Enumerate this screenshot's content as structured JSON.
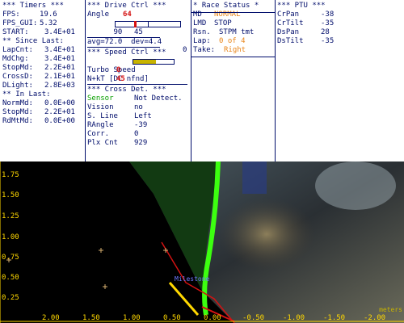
{
  "timers": {
    "header": "*** Timers ***",
    "fps_label": "FPS:",
    "fps_value": "19.6",
    "fps_gui_label": "FPS_GUI:",
    "fps_gui_value": "5.32",
    "start_label": "START:",
    "start_value": "3.4E+01",
    "since_last_header": "** Since Last:",
    "items": [
      {
        "label": "LapCnt:",
        "value": "3.4E+01"
      },
      {
        "label": "MdChg:",
        "value": "3.4E+01"
      },
      {
        "label": "StopMd:",
        "value": "2.2E+01"
      },
      {
        "label": "CrossD:",
        "value": "2.1E+01"
      },
      {
        "label": "DLight:",
        "value": "2.8E+03"
      }
    ],
    "in_last_header": "** In Last:",
    "in_last_items": [
      {
        "label": "NormMd:",
        "value": "0.0E+00"
      },
      {
        "label": "StopMd:",
        "value": "2.2E+01"
      },
      {
        "label": "RdMtMd:",
        "value": "0.0E+00"
      }
    ]
  },
  "drive": {
    "header": "*** Drive Ctrl ***",
    "angle_label": "Angle",
    "angle_value": "64",
    "slider_min": "90",
    "slider_max": "0",
    "slider_level": 0.3,
    "slider_center": "45",
    "avg_dev": "avg=72.0  dev=4.4",
    "speed_header": "*** Speed Ctrl ***",
    "speed_label": "Speed",
    "speed_value": "45",
    "speed_level": 0.55,
    "turbo_label": "Turbo",
    "turbo_value": "0",
    "nkt_text": "N+kT [DC nfnd]",
    "cross_header": "*** Cross Det. ***",
    "sensor_label": "Sensor",
    "sensor_value": "Not Detect.",
    "vision_label": "Vision",
    "vision_value": "no",
    "sline_label": "S. Line",
    "sline_value": "Left",
    "rangle_label": "RAngle",
    "rangle_value": "-39",
    "corr_label": "Corr.",
    "corr_value": "0",
    "plx_label": "Plx Cnt",
    "plx_value": "929"
  },
  "race": {
    "header": "* Race Status *",
    "md_label": "MD",
    "md_value": "NORMAL",
    "lmd_label": "LMD",
    "lmd_value": "STOP",
    "rsn_label": "Rsn.",
    "rsn_value": "STPM tmt",
    "lap_label": "Lap:",
    "lap_value": "0 of 4",
    "take_label": "Take:",
    "take_value": "Right"
  },
  "ptu": {
    "header": "*** PTU ***",
    "items": [
      {
        "label": "CrPan",
        "value": "-38"
      },
      {
        "label": "CrTilt",
        "value": "-35"
      },
      {
        "label": "DsPan",
        "value": "28"
      },
      {
        "label": "DsTilt",
        "value": "-35"
      }
    ]
  },
  "camera": {
    "y_ticks": [
      "1.75",
      "1.50",
      "1.25",
      "1.00",
      "0.75",
      "0.50",
      "0.25"
    ],
    "x_ticks": [
      "2.00",
      "1.50",
      "1.00",
      "0.50",
      "0.00",
      "-0.50",
      "-1.00",
      "-1.50",
      "-2.00"
    ],
    "tag": "Milestone",
    "corner_label": "meters"
  },
  "colors": {
    "text": "#000d6b",
    "red": "#d41212",
    "green": "#0aa000",
    "orange": "#e88418",
    "yellow": "#ffd800",
    "lime": "#40ff10"
  }
}
